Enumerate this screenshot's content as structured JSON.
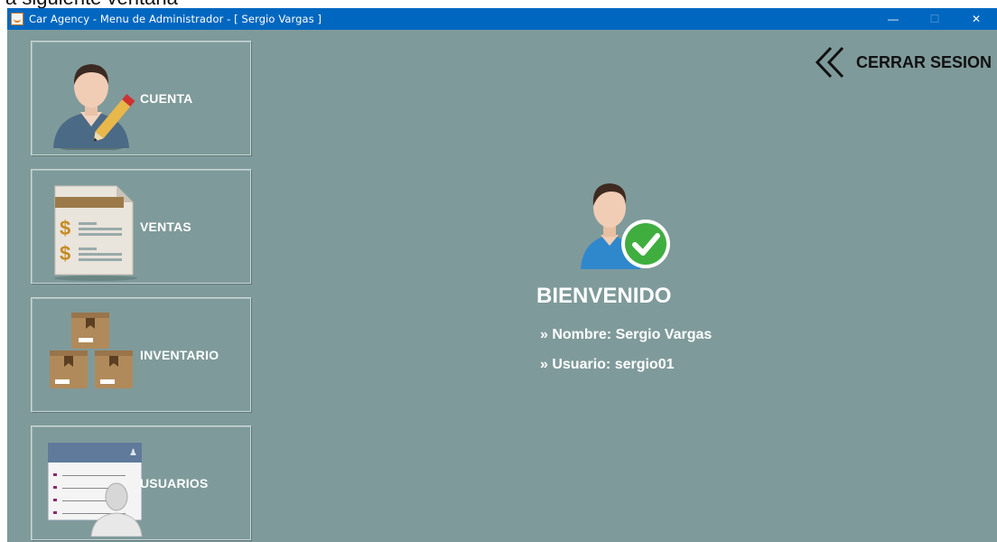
{
  "background_text": "a siguiente ventana",
  "window": {
    "title": "Car Agency - Menu de Administrador - [ Sergio Vargas ]",
    "controls": {
      "minimize": "—",
      "maximize": "☐",
      "close": "✕"
    }
  },
  "menu": {
    "cuenta": "CUENTA",
    "ventas": "VENTAS",
    "inventario": "INVENTARIO",
    "usuarios": "USUARIOS"
  },
  "logout": {
    "label": "CERRAR SESION",
    "icon": "double-chevron-left-icon"
  },
  "welcome": {
    "title": "BIENVENIDO",
    "name_line": "» Nombre: Sergio Vargas",
    "user_line": "» Usuario: sergio01"
  },
  "colors": {
    "background": "#7f9a9a",
    "titlebar": "#0067c0",
    "check_green": "#3fae3f"
  }
}
